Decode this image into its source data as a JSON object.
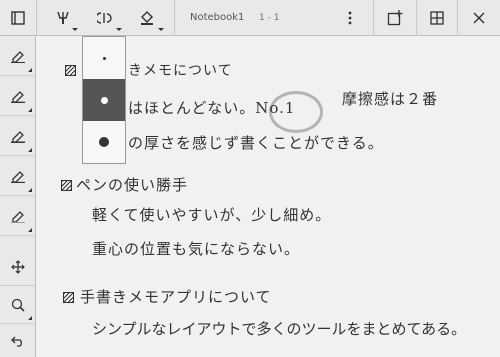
{
  "toolbar": {
    "notebook_title": "Notebook1",
    "page_indicator": "1 - 1",
    "icons": [
      "menu-icon",
      "pen-tool-icon",
      "eraser-tool-icon",
      "fill-icon",
      "more-icon",
      "add-page-icon",
      "grid-icon",
      "close-icon"
    ]
  },
  "left_tools": [
    "pen-style-1-icon",
    "pen-style-2-icon",
    "pen-style-3-icon",
    "pen-style-4-icon",
    "pen-style-5-icon",
    "move-icon",
    "zoom-icon",
    "undo-icon"
  ],
  "thickness_popup": {
    "options": [
      "thin",
      "medium",
      "thick"
    ],
    "selected": "medium"
  },
  "note": {
    "heading1": "きメモについて",
    "line1a": "はほとんどない。No.1",
    "line1b": "摩擦感は２番",
    "line2": "の厚さを感じず書くことができる。",
    "heading2": "ペンの使い勝手",
    "line3": "軽くて使いやすいが、少し細め。",
    "line4": "重心の位置も気にならない。",
    "heading3": "手書きメモアプリについて",
    "line5": "シンプルなレイアウトで多くのツールをまとめてある。"
  },
  "colors": {
    "background": "#eeeeee",
    "ink": "#333333",
    "selected_option": "#555555"
  }
}
